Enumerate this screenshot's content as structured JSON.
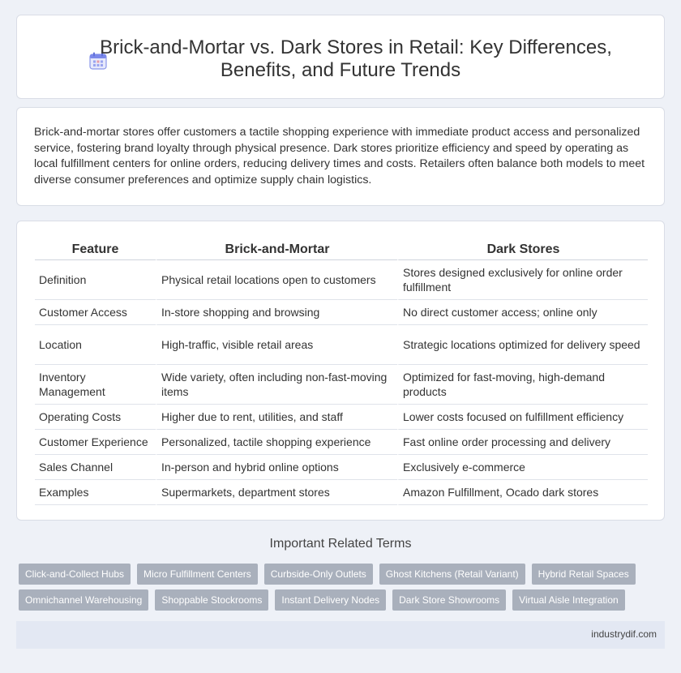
{
  "header": {
    "title_line1": "Brick-and-Mortar vs. Dark Stores in Retail: Key Differences,",
    "title_line2": "Benefits, and Future Trends",
    "icon": "calendar-icon"
  },
  "intro": {
    "text": "Brick-and-mortar stores offer customers a tactile shopping experience with immediate product access and personalized service, fostering brand loyalty through physical presence. Dark stores prioritize efficiency and speed by operating as local fulfillment centers for online orders, reducing delivery times and costs. Retailers often balance both models to meet diverse consumer preferences and optimize supply chain logistics."
  },
  "table": {
    "headers": [
      "Feature",
      "Brick-and-Mortar",
      "Dark Stores"
    ],
    "rows": [
      [
        "Definition",
        "Physical retail locations open to customers",
        "Stores designed exclusively for online order fulfillment"
      ],
      [
        "Customer Access",
        "In-store shopping and browsing",
        "No direct customer access; online only"
      ],
      [
        "Location",
        "High-traffic, visible retail areas",
        "Strategic locations optimized for delivery speed"
      ],
      [
        "Inventory Management",
        "Wide variety, often including non-fast-moving items",
        "Optimized for fast-moving, high-demand products"
      ],
      [
        "Operating Costs",
        "Higher due to rent, utilities, and staff",
        "Lower costs focused on fulfillment efficiency"
      ],
      [
        "Customer Experience",
        "Personalized, tactile shopping experience",
        "Fast online order processing and delivery"
      ],
      [
        "Sales Channel",
        "In-person and hybrid online options",
        "Exclusively e-commerce"
      ],
      [
        "Examples",
        "Supermarkets, department stores",
        "Amazon Fulfillment, Ocado dark stores"
      ]
    ]
  },
  "related": {
    "title": "Important Related Terms",
    "tags": [
      "Click-and-Collect Hubs",
      "Micro Fulfillment Centers",
      "Curbside-Only Outlets",
      "Ghost Kitchens (Retail Variant)",
      "Hybrid Retail Spaces",
      "Omnichannel Warehousing",
      "Shoppable Stockrooms",
      "Instant Delivery Nodes",
      "Dark Store Showrooms",
      "Virtual Aisle Integration"
    ]
  },
  "footer": {
    "site": "industrydif.com"
  },
  "colors": {
    "background": "#eef1f7",
    "tag": "#a9b0bc",
    "footer": "#e3e8f3",
    "icon_accent": "#6f7de8"
  }
}
